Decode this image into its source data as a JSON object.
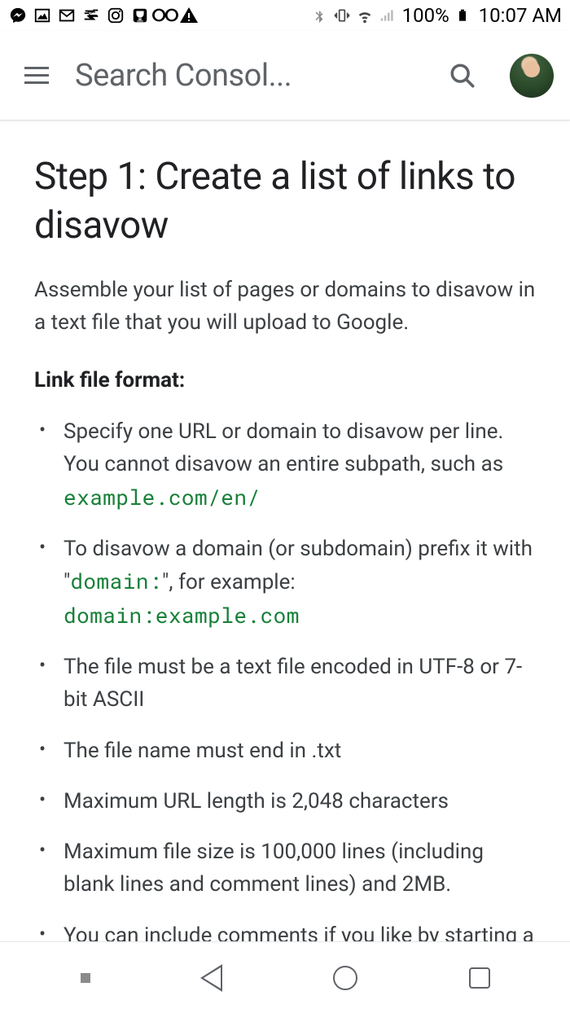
{
  "status": {
    "battery_pct": "100%",
    "time": "10:07 AM"
  },
  "header": {
    "title": "Search Consol..."
  },
  "content": {
    "heading": "Step 1: Create a list of links to disavow",
    "intro": "Assemble your list of pages or domains to disavow in a text file that you will upload to Google.",
    "subhead": "Link file format:",
    "bullets": [
      {
        "pre": "Specify one URL or domain to disavow per line. You cannot disavow an entire subpath, such as ",
        "code": "example.com/en/"
      },
      {
        "pre": "To disavow a domain (or subdomain) prefix it with \"",
        "code": "domain:",
        "mid": "\", for example: ",
        "code2": "domain:example.com"
      },
      {
        "pre": "The file must be a text file encoded in UTF-8 or 7-bit ASCII"
      },
      {
        "pre": "The file name must end in .txt"
      },
      {
        "pre": "Maximum URL length is 2,048 characters"
      },
      {
        "pre": "Maximum file size is 100,000 lines (including blank lines and comment lines) and 2MB."
      },
      {
        "pre": "You can include comments if you like by starting a line with a # mark. Any lines that begin with # will be ignored by Google."
      }
    ]
  }
}
